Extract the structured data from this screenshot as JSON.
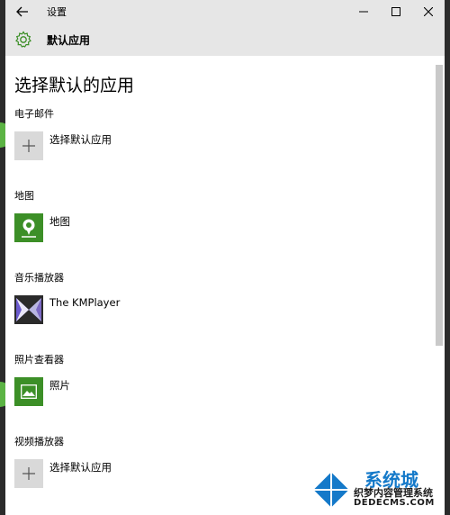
{
  "window": {
    "title": "设置",
    "header_title": "默认应用"
  },
  "page": {
    "title": "选择默认的应用"
  },
  "sections": [
    {
      "label": "电子邮件",
      "app": "选择默认应用",
      "icon": "plus-icon"
    },
    {
      "label": "地图",
      "app": "地图",
      "icon": "maps-icon"
    },
    {
      "label": "音乐播放器",
      "app": "The KMPlayer",
      "icon": "kmplayer-icon"
    },
    {
      "label": "照片查看器",
      "app": "照片",
      "icon": "photos-icon"
    },
    {
      "label": "视频播放器",
      "app": "选择默认应用",
      "icon": "plus-icon"
    }
  ],
  "watermark": {
    "brand": "系统城",
    "line1": "织梦内容管理系统",
    "line2": "DEDECMS.COM"
  },
  "colors": {
    "titlebar": "#e6e6e6",
    "app_green": "#3c8f27",
    "plus_bg": "#d9d9d9"
  }
}
